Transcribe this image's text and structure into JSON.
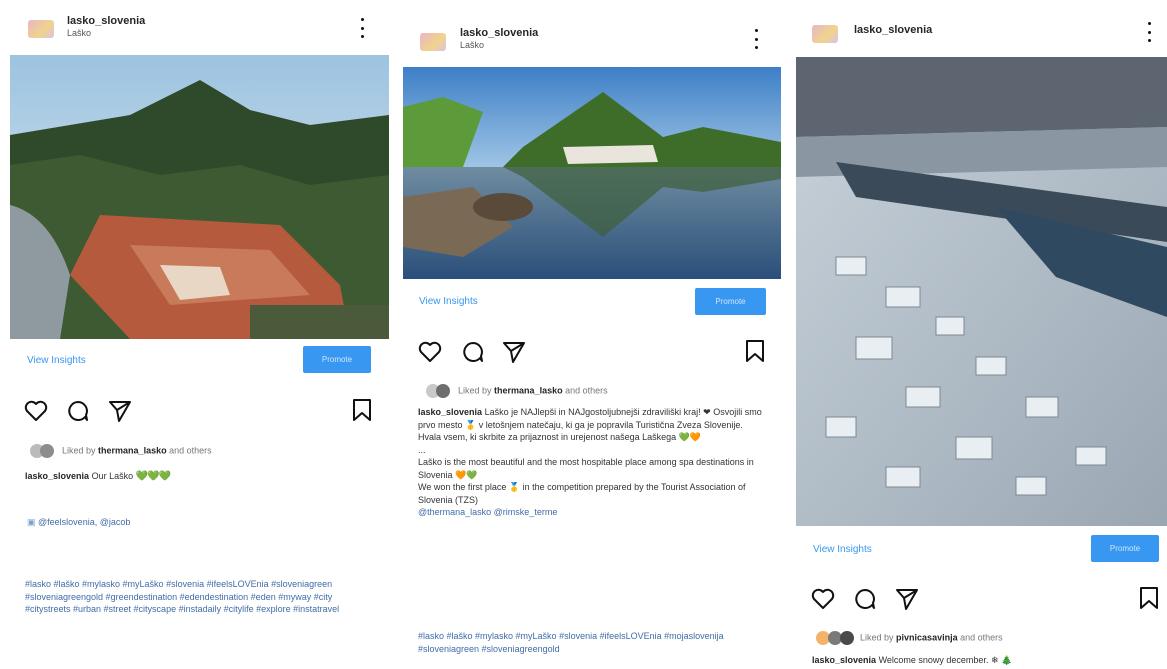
{
  "posts": [
    {
      "username": "lasko_slovenia",
      "location": "Laško",
      "view_insights": "View Insights",
      "promote": "Promote",
      "liked_prefix": "Liked by",
      "liked_user": "thermana_lasko",
      "liked_suffix": "and others",
      "caption_user": "lasko_slovenia",
      "caption_text": "Our Laško",
      "caption_emoji": "💚💚💚",
      "credit": "@feelslovenia, @jacob",
      "hashtags": "#lasko #laško #mylasko #myLaško #slovenia #ifeelsLOVEnia #sloveniagreen #sloveniagreengold #greendestination #edendestination #eden #myway #city #citystreets #urban #street #cityscape #instadaily #citylife #explore #instatravel"
    },
    {
      "username": "lasko_slovenia",
      "location": "Laško",
      "view_insights": "View Insights",
      "promote": "Promote",
      "liked_prefix": "Liked by",
      "liked_user": "thermana_lasko",
      "liked_suffix": "and others",
      "caption_user": "lasko_slovenia",
      "caption_text": "Laško je NAJlepši in NAJgostoljubnejši zdraviliški kraj! ❤ Osvojili smo prvo mesto 🥇 v letošnjem natečaju, ki ga je popravila Turistična Zveza Slovenije. Hvala vsem, ki skrbite za prijaznost in urejenost našega Laškega 💚🧡",
      "ellipsis": "...",
      "caption_en_1": "Laško is the most beautiful and the most hospitable place among spa destinations in Slovenia 🧡💚",
      "caption_en_2": "We won the first place 🥇 in the competition prepared by the Tourist Association of Slovenia (TZS)",
      "mentions": "@thermana_lasko @rimske_terme",
      "hashtags": "#lasko #laško #mylasko #myLaško #slovenia #ifeelsLOVEnia #mojaslovenija #sloveniagreen #sloveniagreengold"
    },
    {
      "username": "lasko_slovenia",
      "view_insights": "View Insights",
      "promote": "Promote",
      "liked_prefix": "Liked by",
      "liked_user": "pivnicasavinja",
      "liked_suffix": "and others",
      "caption_user": "lasko_slovenia",
      "caption_text": "Welcome snowy december. ❄ 🎄"
    }
  ],
  "icons": [
    "heart-icon",
    "comment-icon",
    "share-icon",
    "bookmark-icon",
    "more-icon"
  ],
  "colors": {
    "link": "#3897f0",
    "hashtag": "#3f6da8",
    "hearts": "#5bc236"
  }
}
